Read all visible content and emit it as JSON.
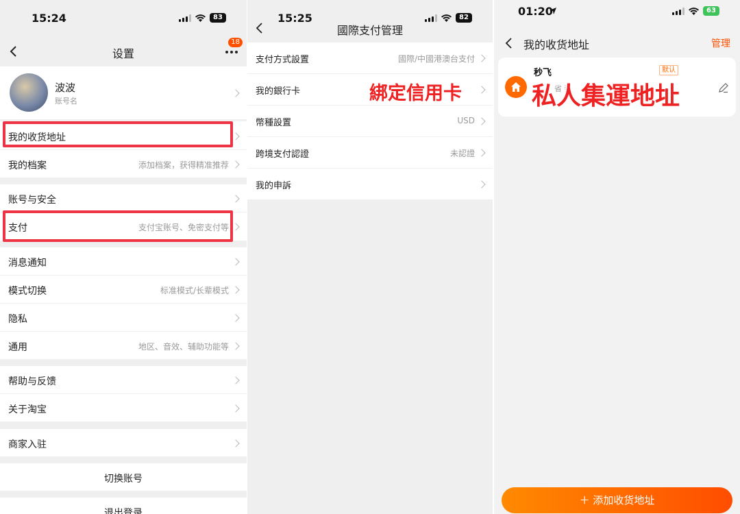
{
  "panel1": {
    "status_time": "15:24",
    "battery": "83",
    "title": "设置",
    "more_badge": "18",
    "profile": {
      "name": "波波",
      "account": "账号名"
    },
    "rows": [
      {
        "label": "我的收货地址",
        "value": ""
      },
      {
        "label": "我的档案",
        "value": "添加档案，获得精准推荐"
      },
      {
        "label": "账号与安全",
        "value": ""
      },
      {
        "label": "支付",
        "value": "支付宝账号、免密支付等"
      },
      {
        "label": "消息通知",
        "value": ""
      },
      {
        "label": "模式切换",
        "value": "标准模式/长辈模式"
      },
      {
        "label": "隐私",
        "value": ""
      },
      {
        "label": "通用",
        "value": "地区、音效、辅助功能等"
      },
      {
        "label": "帮助与反馈",
        "value": ""
      },
      {
        "label": "关于淘宝",
        "value": ""
      },
      {
        "label": "商家入驻",
        "value": ""
      }
    ],
    "switch_account": "切换账号",
    "logout": "退出登录"
  },
  "panel2": {
    "status_time": "15:25",
    "battery": "82",
    "title": "國際支付管理",
    "rows": [
      {
        "label": "支付方式設置",
        "value": "國際/中國港澳台支付"
      },
      {
        "label": "我的銀行卡",
        "value": ""
      },
      {
        "label": "幣種設置",
        "value": "USD"
      },
      {
        "label": "跨境支付認證",
        "value": "未認證"
      },
      {
        "label": "我的申訴",
        "value": ""
      }
    ],
    "annotation": "綁定信用卡"
  },
  "panel3": {
    "status_time": "01:20",
    "battery": "63",
    "title": "我的收货地址",
    "manage": "管理",
    "address": {
      "name": "秒飞",
      "line": "省   莞",
      "default_tag": "默认"
    },
    "annotation": "私人集運地址",
    "add_button": "＋ 添加收货地址"
  },
  "colors": {
    "accent": "#ff5000",
    "highlight_box": "#ee3344",
    "annotation": "#ee2222"
  }
}
